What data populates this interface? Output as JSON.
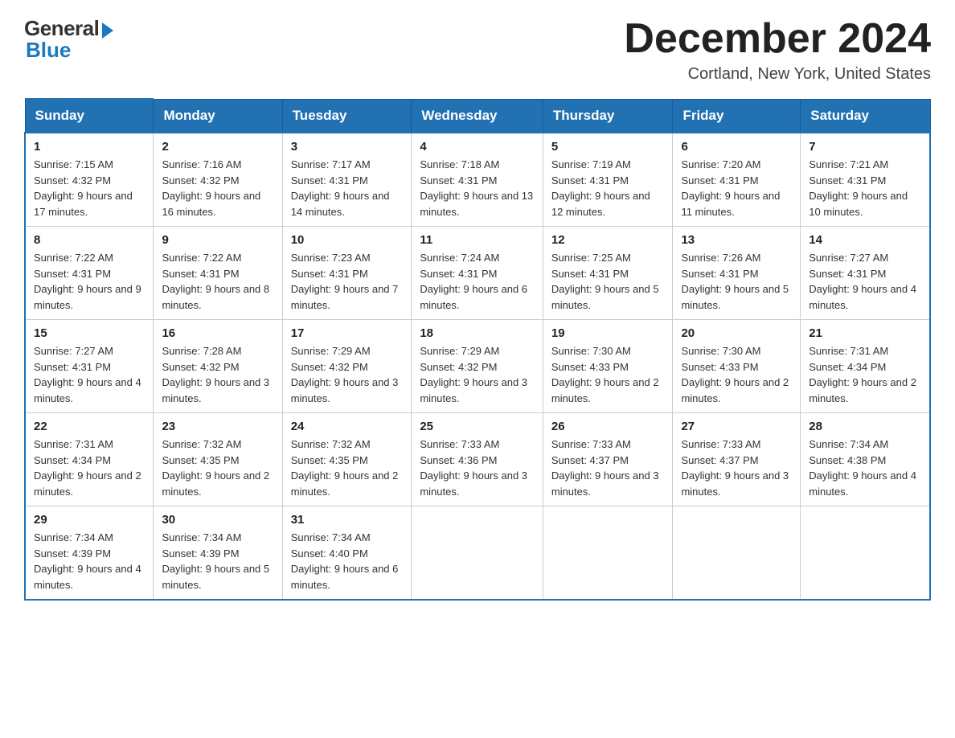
{
  "header": {
    "logo_general": "General",
    "logo_blue": "Blue",
    "month_title": "December 2024",
    "location": "Cortland, New York, United States"
  },
  "weekdays": [
    "Sunday",
    "Monday",
    "Tuesday",
    "Wednesday",
    "Thursday",
    "Friday",
    "Saturday"
  ],
  "weeks": [
    [
      {
        "day": "1",
        "sunrise": "7:15 AM",
        "sunset": "4:32 PM",
        "daylight": "9 hours and 17 minutes."
      },
      {
        "day": "2",
        "sunrise": "7:16 AM",
        "sunset": "4:32 PM",
        "daylight": "9 hours and 16 minutes."
      },
      {
        "day": "3",
        "sunrise": "7:17 AM",
        "sunset": "4:31 PM",
        "daylight": "9 hours and 14 minutes."
      },
      {
        "day": "4",
        "sunrise": "7:18 AM",
        "sunset": "4:31 PM",
        "daylight": "9 hours and 13 minutes."
      },
      {
        "day": "5",
        "sunrise": "7:19 AM",
        "sunset": "4:31 PM",
        "daylight": "9 hours and 12 minutes."
      },
      {
        "day": "6",
        "sunrise": "7:20 AM",
        "sunset": "4:31 PM",
        "daylight": "9 hours and 11 minutes."
      },
      {
        "day": "7",
        "sunrise": "7:21 AM",
        "sunset": "4:31 PM",
        "daylight": "9 hours and 10 minutes."
      }
    ],
    [
      {
        "day": "8",
        "sunrise": "7:22 AM",
        "sunset": "4:31 PM",
        "daylight": "9 hours and 9 minutes."
      },
      {
        "day": "9",
        "sunrise": "7:22 AM",
        "sunset": "4:31 PM",
        "daylight": "9 hours and 8 minutes."
      },
      {
        "day": "10",
        "sunrise": "7:23 AM",
        "sunset": "4:31 PM",
        "daylight": "9 hours and 7 minutes."
      },
      {
        "day": "11",
        "sunrise": "7:24 AM",
        "sunset": "4:31 PM",
        "daylight": "9 hours and 6 minutes."
      },
      {
        "day": "12",
        "sunrise": "7:25 AM",
        "sunset": "4:31 PM",
        "daylight": "9 hours and 5 minutes."
      },
      {
        "day": "13",
        "sunrise": "7:26 AM",
        "sunset": "4:31 PM",
        "daylight": "9 hours and 5 minutes."
      },
      {
        "day": "14",
        "sunrise": "7:27 AM",
        "sunset": "4:31 PM",
        "daylight": "9 hours and 4 minutes."
      }
    ],
    [
      {
        "day": "15",
        "sunrise": "7:27 AM",
        "sunset": "4:31 PM",
        "daylight": "9 hours and 4 minutes."
      },
      {
        "day": "16",
        "sunrise": "7:28 AM",
        "sunset": "4:32 PM",
        "daylight": "9 hours and 3 minutes."
      },
      {
        "day": "17",
        "sunrise": "7:29 AM",
        "sunset": "4:32 PM",
        "daylight": "9 hours and 3 minutes."
      },
      {
        "day": "18",
        "sunrise": "7:29 AM",
        "sunset": "4:32 PM",
        "daylight": "9 hours and 3 minutes."
      },
      {
        "day": "19",
        "sunrise": "7:30 AM",
        "sunset": "4:33 PM",
        "daylight": "9 hours and 2 minutes."
      },
      {
        "day": "20",
        "sunrise": "7:30 AM",
        "sunset": "4:33 PM",
        "daylight": "9 hours and 2 minutes."
      },
      {
        "day": "21",
        "sunrise": "7:31 AM",
        "sunset": "4:34 PM",
        "daylight": "9 hours and 2 minutes."
      }
    ],
    [
      {
        "day": "22",
        "sunrise": "7:31 AM",
        "sunset": "4:34 PM",
        "daylight": "9 hours and 2 minutes."
      },
      {
        "day": "23",
        "sunrise": "7:32 AM",
        "sunset": "4:35 PM",
        "daylight": "9 hours and 2 minutes."
      },
      {
        "day": "24",
        "sunrise": "7:32 AM",
        "sunset": "4:35 PM",
        "daylight": "9 hours and 2 minutes."
      },
      {
        "day": "25",
        "sunrise": "7:33 AM",
        "sunset": "4:36 PM",
        "daylight": "9 hours and 3 minutes."
      },
      {
        "day": "26",
        "sunrise": "7:33 AM",
        "sunset": "4:37 PM",
        "daylight": "9 hours and 3 minutes."
      },
      {
        "day": "27",
        "sunrise": "7:33 AM",
        "sunset": "4:37 PM",
        "daylight": "9 hours and 3 minutes."
      },
      {
        "day": "28",
        "sunrise": "7:34 AM",
        "sunset": "4:38 PM",
        "daylight": "9 hours and 4 minutes."
      }
    ],
    [
      {
        "day": "29",
        "sunrise": "7:34 AM",
        "sunset": "4:39 PM",
        "daylight": "9 hours and 4 minutes."
      },
      {
        "day": "30",
        "sunrise": "7:34 AM",
        "sunset": "4:39 PM",
        "daylight": "9 hours and 5 minutes."
      },
      {
        "day": "31",
        "sunrise": "7:34 AM",
        "sunset": "4:40 PM",
        "daylight": "9 hours and 6 minutes."
      },
      null,
      null,
      null,
      null
    ]
  ]
}
